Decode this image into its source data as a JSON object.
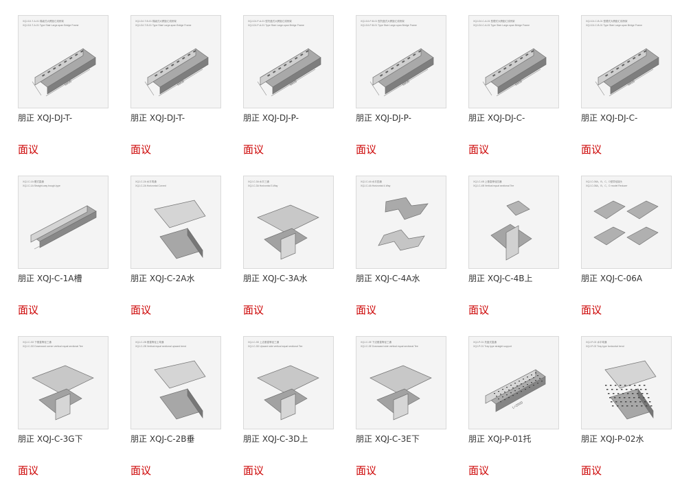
{
  "products": [
    {
      "name": "朋正 XQJ-DJ-T-",
      "action": "面议",
      "image_caption": [
        "XQJ-DJ-T-A-01 梯级式大跨距汇线桥架",
        "XQJ-DJ-T-A-01 Type Stair Large-span Bridge Frame"
      ],
      "image_dimension": "6000",
      "icon": "tray-frame-icon"
    },
    {
      "name": "朋正 XQJ-DJ-T-",
      "action": "面议",
      "image_caption": [
        "XQJ-DJ-T-B-01 梯级式大跨距汇线桥架",
        "XQJ-DJ-T-B-01 Type Stair Large-span Bridge Frame"
      ],
      "image_dimension": "6000",
      "icon": "tray-frame-icon"
    },
    {
      "name": "朋正 XQJ-DJ-P-",
      "action": "面议",
      "image_caption": [
        "XQJ-DJ-P-A-01 型托盘式大跨距汇线桥架",
        "XQJ-DJ-P-A-01 Type Stair Large-span Bridge Frame"
      ],
      "image_dimension": "6000",
      "icon": "tray-frame-icon"
    },
    {
      "name": "朋正 XQJ-DJ-P-",
      "action": "面议",
      "image_caption": [
        "XQJ-DJ-P-B-01 型托盘式大跨距汇线桥架",
        "XQJ-DJ-P-B-01 Type Stair Large-span Bridge Frame"
      ],
      "image_dimension": "6000",
      "icon": "tray-frame-icon"
    },
    {
      "name": "朋正 XQJ-DJ-C-",
      "action": "面议",
      "image_caption": [
        "XQJ-DJ-C-A-01 型槽式大跨距汇线桥架",
        "XQJ-DJ-C-A-01 Type Stair Large-span Bridge Frame"
      ],
      "image_dimension": "6000",
      "icon": "tray-frame-icon"
    },
    {
      "name": "朋正 XQJ-DJ-C-",
      "action": "面议",
      "image_caption": [
        "XQJ-DJ-C-B-01 型槽式大跨距汇线桥架",
        "XQJ-DJ-C-B-01 Type Stair Large-span Bridge Frame"
      ],
      "image_dimension": "6000",
      "icon": "tray-frame-icon"
    },
    {
      "name": "朋正 XQJ-C-1A槽",
      "action": "面议",
      "image_caption": [
        "XQJ-C-1A 槽式直通",
        "XQJ-C-1A Straight-way trough-type"
      ],
      "image_dimension": "",
      "icon": "straight-trough-icon"
    },
    {
      "name": "朋正 XQJ-C-2A水",
      "action": "面议",
      "image_caption": [
        "XQJ-C-2A 水平弯通",
        "XQJ-C-2A Horizontal Curved"
      ],
      "image_dimension": "",
      "icon": "horizontal-bend-icon"
    },
    {
      "name": "朋正 XQJ-C-3A水",
      "action": "面议",
      "image_caption": [
        "XQJ-C-3A 水平三通",
        "XQJ-C-3A Horizontal 3-Way"
      ],
      "image_dimension": "",
      "icon": "tee-junction-icon"
    },
    {
      "name": "朋正 XQJ-C-4A水",
      "action": "面议",
      "image_caption": [
        "XQJ-C-4A 水平四通",
        "XQJ-C-4A Horizontal 4-Way"
      ],
      "image_dimension": "",
      "icon": "cross-junction-icon"
    },
    {
      "name": "朋正 XQJ-C-4B上",
      "action": "面议",
      "image_caption": [
        "XQJ-C-4B 上垂直等径四通",
        "XQJ-C-4B Vertical equal sectional Tee"
      ],
      "image_dimension": "",
      "icon": "vertical-cross-icon"
    },
    {
      "name": "朋正 XQJ-C-06A",
      "action": "面议",
      "image_caption": [
        "XQJ-C-06A、B、C、D型异径接头",
        "XQJ-C-06A、B、C、D model Reducer"
      ],
      "image_dimension": "",
      "icon": "reducer-icon"
    },
    {
      "name": "朋正 XQJ-C-3G下",
      "action": "面议",
      "image_caption": [
        "XQJ-C-3G 下垂直等径三通",
        "XQJ-C-3G Downward corner vertical equal sectional Tee"
      ],
      "image_dimension": "",
      "icon": "downward-tee-icon"
    },
    {
      "name": "朋正 XQJ-C-2B垂",
      "action": "面议",
      "image_caption": [
        "XQJ-C-2B 垂直等径上弯通",
        "XQJ-C-2B Vertical equal sectional upward bend"
      ],
      "image_dimension": "",
      "icon": "vertical-bend-icon"
    },
    {
      "name": "朋正 XQJ-C-3D上",
      "action": "面议",
      "image_caption": [
        "XQJ-C-3D 上边垂直等径三通",
        "XQJ-C-3D Upward side vertical equal sectional Tee"
      ],
      "image_dimension": "",
      "icon": "upward-tee-icon"
    },
    {
      "name": "朋正 XQJ-C-3E下",
      "action": "面议",
      "image_caption": [
        "XQJ-C-3E 下边垂直等径三通",
        "XQJ-C-3E Downward side vertical equal sectional Tee"
      ],
      "image_dimension": "",
      "icon": "downward-side-tee-icon"
    },
    {
      "name": "朋正 XQJ-P-01托",
      "action": "面议",
      "image_caption": [
        "XQJ-P-01 托盘式直通",
        "XQJ-P-01 Tray type straight support"
      ],
      "image_dimension": "L=2000",
      "icon": "perforated-tray-icon"
    },
    {
      "name": "朋正 XQJ-P-02水",
      "action": "面议",
      "image_caption": [
        "XQJ-P-02 水平弯通",
        "XQJ-P-02 Tray type horizontal bend"
      ],
      "image_dimension": "",
      "icon": "perforated-bend-icon"
    }
  ]
}
